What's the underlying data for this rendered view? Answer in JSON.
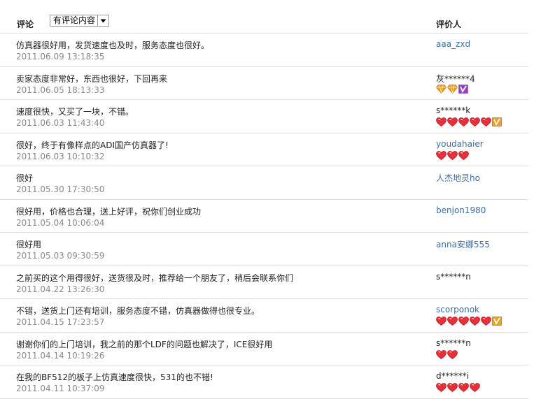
{
  "header": {
    "comment_label": "评论",
    "filter_value": "有评论内容",
    "rater_label": "评价人"
  },
  "colors": {
    "link": "#3a6ea5",
    "date": "#8a8a8a",
    "heart": "#e8303a",
    "diamond": "#f0a020",
    "vip_purple": "#9b3fc4",
    "vip_orange": "#f0a020"
  },
  "reviews": [
    {
      "text": "仿真器很好用，发货速度也及时，服务态度也很好。",
      "date": "2011.06.09 13:18:35",
      "user": "aaa_zxd",
      "user_link": true,
      "badges": []
    },
    {
      "text": "卖家态度非常好，东西也很好，下回再来",
      "date": "2011.06.05 18:13:33",
      "user": "灰******4",
      "user_link": false,
      "badges": [
        "diamond",
        "diamond",
        "vip-purple"
      ]
    },
    {
      "text": "速度很快，又买了一块，不错。",
      "date": "2011.06.03 11:43:40",
      "user": "s******k",
      "user_link": false,
      "badges": [
        "heart",
        "heart",
        "heart",
        "heart",
        "heart",
        "vip-orange"
      ]
    },
    {
      "text": "很好，终于有像样点的ADI国产仿真器了!",
      "date": "2011.06.03 10:10:32",
      "user": "youdahaier",
      "user_link": true,
      "badges": [
        "heart",
        "heart",
        "heart"
      ]
    },
    {
      "text": "很好",
      "date": "2011.05.30 17:30:50",
      "user": "人杰地灵ho",
      "user_link": true,
      "badges": []
    },
    {
      "text": "很好用，价格也合理，送上好评，祝你们创业成功",
      "date": "2011.05.04 10:06:04",
      "user": "benjon1980",
      "user_link": true,
      "badges": []
    },
    {
      "text": "很好用",
      "date": "2011.05.03 09:30:59",
      "user": "anna安娜555",
      "user_link": true,
      "badges": []
    },
    {
      "text": "之前买的这个用得很好，送货很及时，推荐给一个朋友了，稍后会联系你们",
      "date": "2011.04.22 13:26:30",
      "user": "s******n",
      "user_link": false,
      "badges": []
    },
    {
      "text": "不错，送货上门还有培训，服务态度不错，仿真器做得也很专业。",
      "date": "2011.04.15 17:23:57",
      "user": "scorponok",
      "user_link": true,
      "badges": [
        "heart",
        "heart",
        "heart",
        "heart",
        "heart",
        "vip-orange"
      ]
    },
    {
      "text": "谢谢你们的上门培训，我之前的那个LDF的问题也解决了，ICE很好用",
      "date": "2011.04.14 10:19:26",
      "user": "s******n",
      "user_link": false,
      "badges": [
        "heart",
        "heart"
      ]
    },
    {
      "text": "在我的BF512的板子上仿真速度很快，531的也不错!",
      "date": "2011.04.11 10:37:09",
      "user": "d******i",
      "user_link": false,
      "badges": [
        "heart",
        "heart",
        "heart",
        "heart"
      ]
    }
  ]
}
